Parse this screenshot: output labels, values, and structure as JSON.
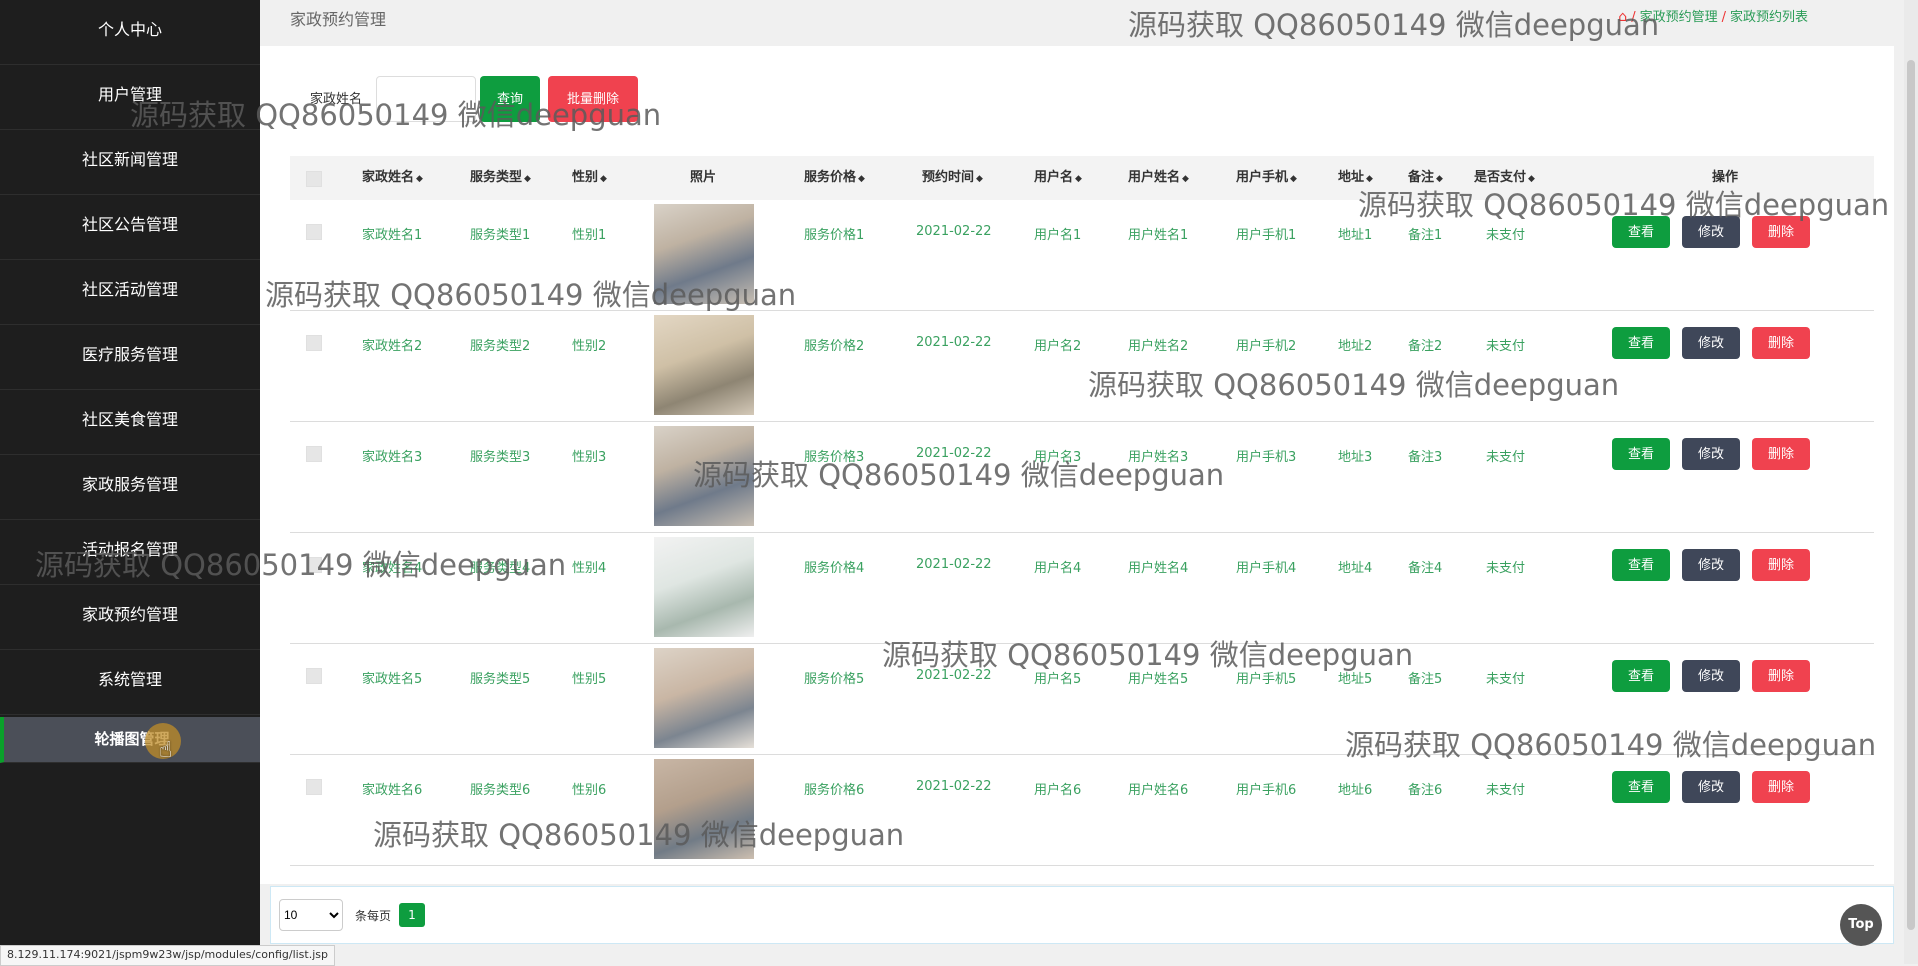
{
  "sidebar": {
    "items": [
      {
        "label": "个人中心"
      },
      {
        "label": "用户管理"
      },
      {
        "label": "社区新闻管理"
      },
      {
        "label": "社区公告管理"
      },
      {
        "label": "社区活动管理"
      },
      {
        "label": "医疗服务管理"
      },
      {
        "label": "社区美食管理"
      },
      {
        "label": "家政服务管理"
      },
      {
        "label": "活动报名管理"
      },
      {
        "label": "家政预约管理"
      },
      {
        "label": "系统管理"
      },
      {
        "label": "轮播图管理"
      }
    ],
    "active_index": 11
  },
  "header": {
    "title": "家政预约管理",
    "breadcrumb": [
      "家政预约管理",
      "家政预约列表"
    ]
  },
  "search": {
    "label": "家政姓名",
    "value": "",
    "query_button": "查询",
    "batch_delete_button": "批量删除"
  },
  "table": {
    "columns": [
      "家政姓名",
      "服务类型",
      "性别",
      "照片",
      "服务价格",
      "预约时间",
      "用户名",
      "用户姓名",
      "用户手机",
      "地址",
      "备注",
      "是否支付",
      "操作"
    ],
    "rows": [
      {
        "name": "家政姓名1",
        "type": "服务类型1",
        "gender": "性别1",
        "price": "服务价格1",
        "time": "2021-02-22",
        "username": "用户名1",
        "realname": "用户姓名1",
        "phone": "用户手机1",
        "address": "地址1",
        "note": "备注1",
        "paid": "未支付"
      },
      {
        "name": "家政姓名2",
        "type": "服务类型2",
        "gender": "性别2",
        "price": "服务价格2",
        "time": "2021-02-22",
        "username": "用户名2",
        "realname": "用户姓名2",
        "phone": "用户手机2",
        "address": "地址2",
        "note": "备注2",
        "paid": "未支付"
      },
      {
        "name": "家政姓名3",
        "type": "服务类型3",
        "gender": "性别3",
        "price": "服务价格3",
        "time": "2021-02-22",
        "username": "用户名3",
        "realname": "用户姓名3",
        "phone": "用户手机3",
        "address": "地址3",
        "note": "备注3",
        "paid": "未支付"
      },
      {
        "name": "家政姓名4",
        "type": "服务类型4",
        "gender": "性别4",
        "price": "服务价格4",
        "time": "2021-02-22",
        "username": "用户名4",
        "realname": "用户姓名4",
        "phone": "用户手机4",
        "address": "地址4",
        "note": "备注4",
        "paid": "未支付"
      },
      {
        "name": "家政姓名5",
        "type": "服务类型5",
        "gender": "性别5",
        "price": "服务价格5",
        "time": "2021-02-22",
        "username": "用户名5",
        "realname": "用户姓名5",
        "phone": "用户手机5",
        "address": "地址5",
        "note": "备注5",
        "paid": "未支付"
      },
      {
        "name": "家政姓名6",
        "type": "服务类型6",
        "gender": "性别6",
        "price": "服务价格6",
        "time": "2021-02-22",
        "username": "用户名6",
        "realname": "用户姓名6",
        "phone": "用户手机6",
        "address": "地址6",
        "note": "备注6",
        "paid": "未支付"
      }
    ],
    "actions": {
      "view": "查看",
      "edit": "修改",
      "delete": "删除"
    }
  },
  "pager": {
    "page_size": "10",
    "page_size_text": "条每页",
    "current_page": "1"
  },
  "top_button": "Top",
  "status_url": "8.129.11.174:9021/jspm9w23w/jsp/modules/config/list.jsp",
  "watermark": "源码获取 QQ86050149 微信deepguan",
  "colors": {
    "sidebar_bg": "#1e1e1e",
    "accent_green": "#0e9d3f",
    "text_green": "#3aa160",
    "danger_red": "#f0424f",
    "edit_dark": "#3f4759"
  }
}
